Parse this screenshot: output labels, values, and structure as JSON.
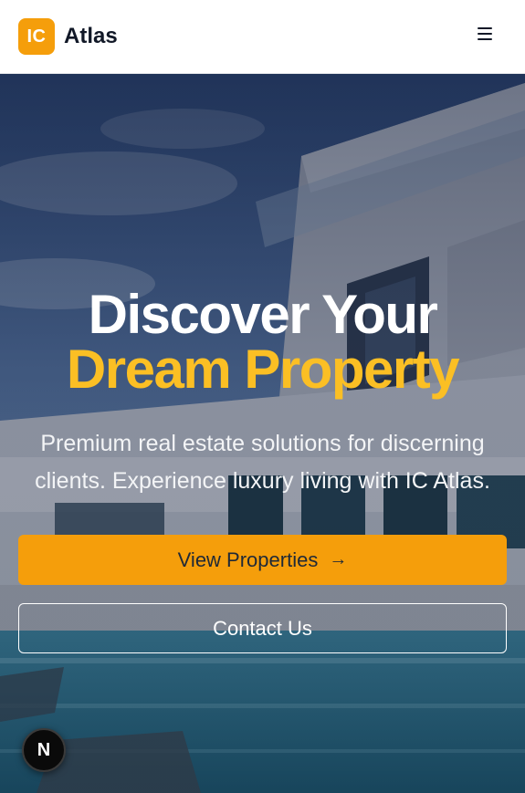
{
  "header": {
    "logo_badge": "IC",
    "brand_name": "Atlas",
    "menu_icon": "hamburger-menu-icon"
  },
  "hero": {
    "headline_line1": "Discover Your",
    "headline_line2": "Dream Property",
    "subtitle_line1": "Premium real estate solutions for discerning",
    "subtitle_line2": "clients. Experience luxury living with IC Atlas.",
    "primary_button": "View Properties",
    "primary_button_icon": "arrow-right-icon",
    "secondary_button": "Contact Us"
  },
  "dev_badge": {
    "label": "N",
    "icon": "nextjs-logo-icon"
  },
  "colors": {
    "accent": "#f59e0b",
    "headline_highlight": "#fbbf24",
    "text_dark": "#111827",
    "white": "#ffffff"
  }
}
